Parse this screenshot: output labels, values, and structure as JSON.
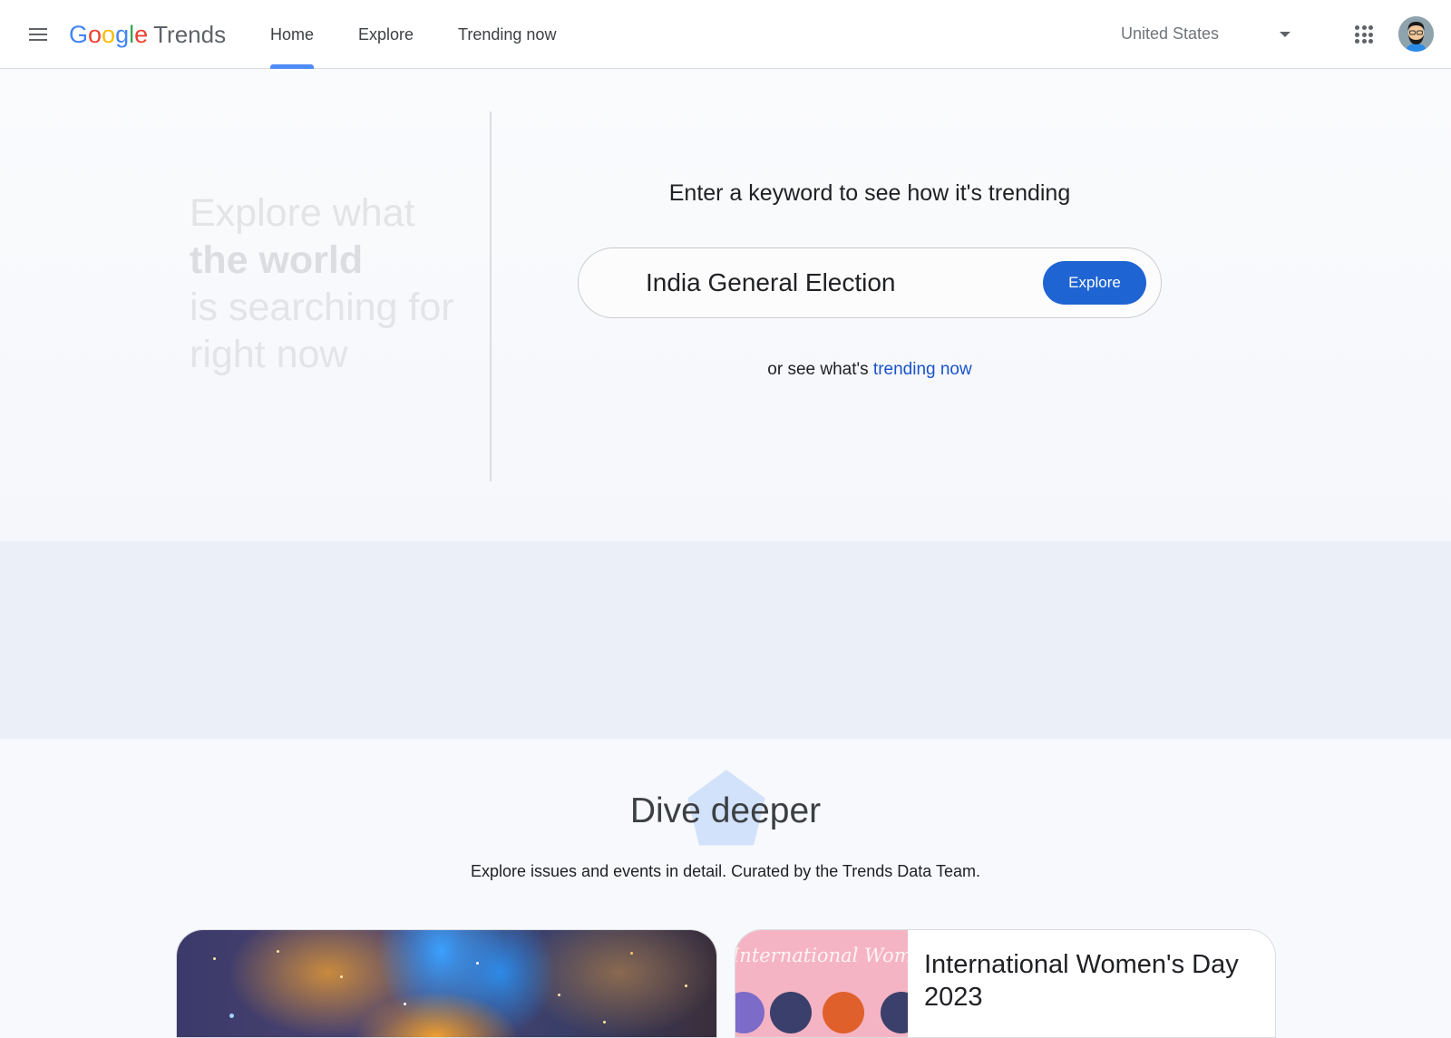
{
  "header": {
    "menu_icon": "hamburger-menu-icon",
    "logo": {
      "google": [
        "G",
        "o",
        "o",
        "g",
        "l",
        "e"
      ],
      "product": "Trends"
    },
    "nav": [
      {
        "label": "Home",
        "active": true
      },
      {
        "label": "Explore",
        "active": false
      },
      {
        "label": "Trending now",
        "active": false
      }
    ],
    "region": {
      "selected": "United States",
      "icon": "caret-down-icon"
    },
    "apps_icon": "apps-grid-icon",
    "avatar_icon": "user-avatar"
  },
  "hero": {
    "tagline": {
      "line1": "Explore what",
      "line2": "the world",
      "line3": "is searching for",
      "line4": "right now"
    },
    "prompt": "Enter a keyword to see how it's trending",
    "search": {
      "value": "India General Election",
      "placeholder": ""
    },
    "explore_button": "Explore",
    "or_see_prefix": "or see what's ",
    "trending_link": "trending now"
  },
  "dive_deeper": {
    "title": "Dive deeper",
    "subtitle": "Explore issues and events in detail. Curated by the Trends Data Team.",
    "cards": [
      {
        "title": "",
        "image": "nebula-space-image"
      },
      {
        "title": "International Women's Day 2023",
        "image_text": "International Women's Day"
      }
    ]
  },
  "colors": {
    "accent": "#1f64d3",
    "link": "#1a53c9",
    "active_tab_indicator": "#4f8df5",
    "band": "#ebeff7"
  }
}
